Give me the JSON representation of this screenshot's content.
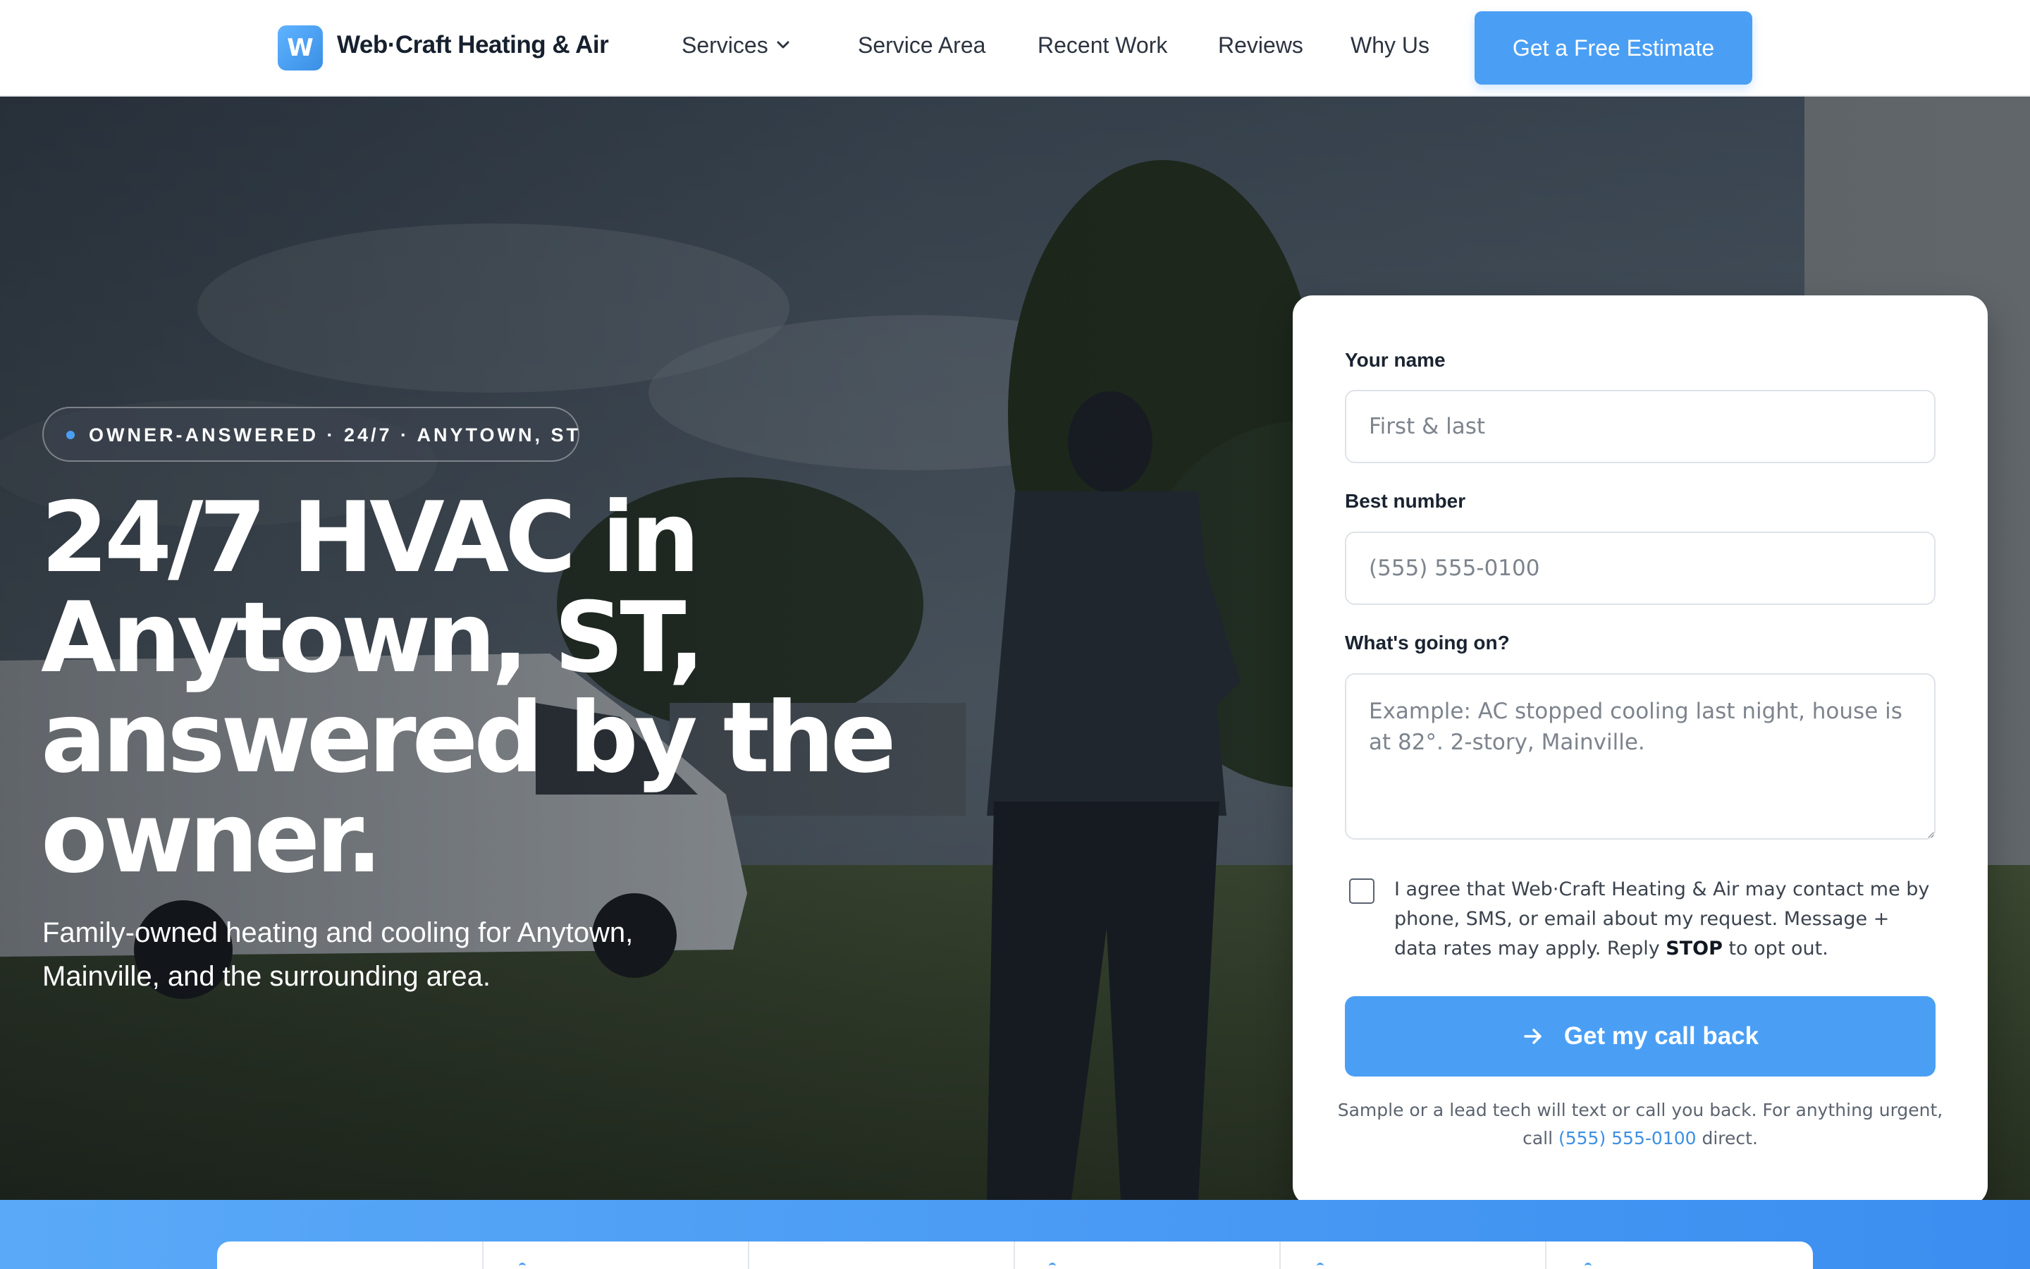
{
  "header": {
    "logo_letter": "W",
    "brand": "Web·Craft Heating & Air",
    "nav": {
      "services": "Services",
      "service_area": "Service Area",
      "recent_work": "Recent Work",
      "reviews": "Reviews",
      "why_us": "Why Us"
    },
    "cta": "Get a Free Estimate"
  },
  "hero": {
    "badge": "OWNER-ANSWERED · 24/7 · ANYTOWN, ST",
    "title": "24/7 HVAC in Anytown, ST, answered by the owner.",
    "subtitle": "Family-owned heating and cooling for Anytown, Mainville, and the surrounding area."
  },
  "form": {
    "name_label": "Your name",
    "name_placeholder": "First & last",
    "phone_label": "Best number",
    "phone_placeholder": "(555) 555-0100",
    "message_label": "What's going on?",
    "message_placeholder": "Example: AC stopped cooling last night, house is at 82°. 2-story, Mainville.",
    "consent_before": "I agree that Web·Craft Heating & Air may contact me by phone, SMS, or email about my request. Message + data rates may apply. Reply ",
    "consent_keyword": "STOP",
    "consent_after": " to opt out.",
    "submit": "Get my call back",
    "footnote_before": "Sample or a lead tech will text or call you back. For anything urgent, call ",
    "footnote_phone": "(555) 555-0100",
    "footnote_after": " direct."
  },
  "colors": {
    "accent": "#4a9ff5",
    "heading": "#16202e",
    "link": "#3d8fe3"
  },
  "icons": {
    "logo": "logo-mark-icon",
    "services_dropdown": "chevron-down-icon",
    "submit": "arrow-right-icon"
  }
}
